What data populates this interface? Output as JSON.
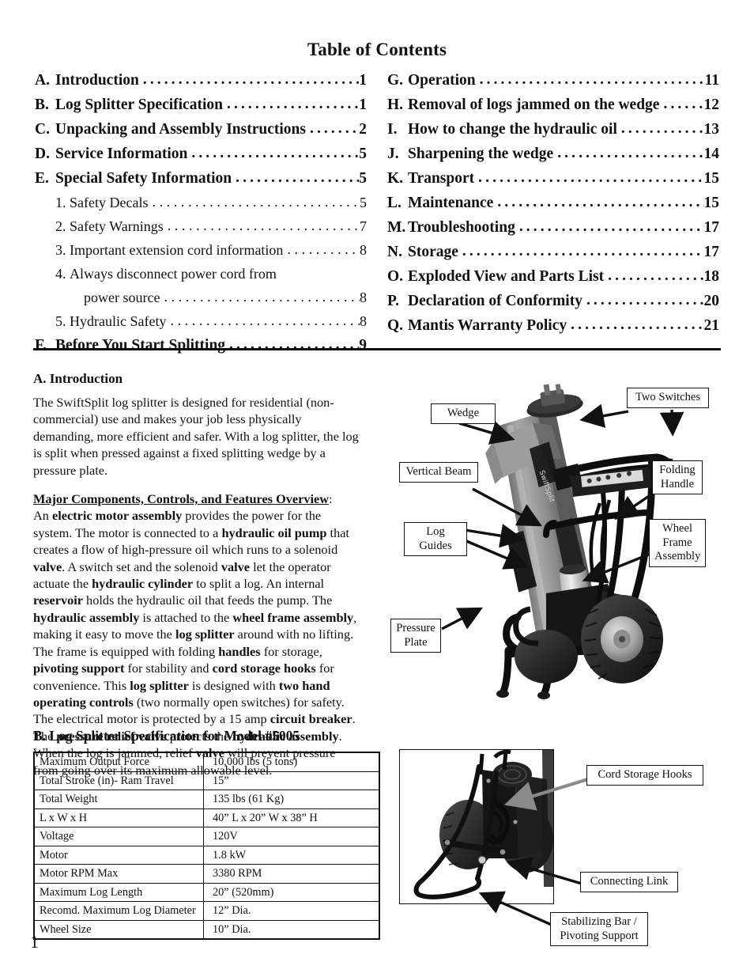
{
  "document": {
    "toc_title": "Table of Contents",
    "page_number": "1"
  },
  "toc": {
    "left_column": [
      {
        "letter": "A.",
        "text": "Introduction",
        "page": "1",
        "level": "main"
      },
      {
        "letter": "B.",
        "text": "Log Splitter Specification",
        "page": "1",
        "level": "main"
      },
      {
        "letter": "C.",
        "text": "Unpacking and Assembly Instructions",
        "page": "2",
        "level": "main"
      },
      {
        "letter": "D.",
        "text": "Service Information",
        "page": "5",
        "level": "main"
      },
      {
        "letter": "E.",
        "text": "Special Safety Information",
        "page": "5",
        "level": "main"
      },
      {
        "letter": "1.",
        "text": "Safety Decals",
        "page": "5",
        "level": "sub"
      },
      {
        "letter": "2.",
        "text": "Safety Warnings",
        "page": "7",
        "level": "sub"
      },
      {
        "letter": "3.",
        "text": "Important extension cord information",
        "page": "8",
        "level": "sub"
      },
      {
        "letter": "4.",
        "text": "Always disconnect power cord from",
        "page": "",
        "level": "sub-nodots"
      },
      {
        "letter": "",
        "text": "power source",
        "page": "8",
        "level": "sub-cont"
      },
      {
        "letter": "5.",
        "text": "Hydraulic Safety",
        "page": "8",
        "level": "sub"
      },
      {
        "letter": "F.",
        "text": "Before You Start Splitting",
        "page": "9",
        "level": "main"
      }
    ],
    "right_column": [
      {
        "letter": "G.",
        "text": "Operation",
        "page": "11",
        "level": "main"
      },
      {
        "letter": "H.",
        "text": "Removal of logs jammed on the wedge",
        "page": "12",
        "level": "main"
      },
      {
        "letter": "I.",
        "text": "How to change the hydraulic oil",
        "page": "13",
        "level": "main"
      },
      {
        "letter": "J.",
        "text": "Sharpening the wedge",
        "page": "14",
        "level": "main"
      },
      {
        "letter": "K.",
        "text": "Transport",
        "page": "15",
        "level": "main"
      },
      {
        "letter": "L.",
        "text": "Maintenance",
        "page": "15",
        "level": "main"
      },
      {
        "letter": "M.",
        "text": "Troubleshooting",
        "page": "17",
        "level": "main"
      },
      {
        "letter": "N.",
        "text": "Storage",
        "page": "17",
        "level": "main"
      },
      {
        "letter": "O.",
        "text": "Exploded View and Parts List",
        "page": "18",
        "level": "main"
      },
      {
        "letter": "P.",
        "text": "Declaration of Conformity",
        "page": "20",
        "level": "main"
      },
      {
        "letter": "Q.",
        "text": "Mantis Warranty Policy",
        "page": "21",
        "level": "main"
      }
    ]
  },
  "section_a": {
    "heading": "A. Introduction",
    "paragraph1": "The SwiftSplit log splitter is designed for residential (non-commercial) use and makes your job less physically demanding, more efficient and safer. With a log splitter, the log is split when pressed against a fixed splitting wedge by a pressure plate.",
    "overview_heading": "Major Components, Controls, and Features Overview",
    "overview_heading_colon": ":",
    "overview_body": "An electric motor assembly provides the power for the system. The motor is connected to a hydraulic oil pump that creates a flow of high-pressure oil which runs to a solenoid valve. A switch set and the solenoid valve let the operator actuate the hydraulic cylinder to split a log. An internal reservoir holds the hydraulic oil that feeds the pump. The hydraulic assembly is attached to the wheel frame assembly, making it easy to move the log splitter around with no lifting. The frame is equipped with folding handles for storage, pivoting support for stability and cord storage hooks for convenience. This log splitter is designed with two hand operating controls (two normally open switches) for safety. The electrical motor is protected by a 15 amp circuit breaker. The pressure relief valve protects the hydraulic assembly. When the log is jammed, relief valve will prevent pressure from going over its maximum allowable level."
  },
  "section_b": {
    "heading": "B. Log Splitter Specification for Model #5005",
    "spec_rows": [
      {
        "label": "Maximum Output Force",
        "value": "10,000 lbs (5 tons)"
      },
      {
        "label": "Total Stroke (in)- Ram Travel",
        "value": "15”"
      },
      {
        "label": "Total Weight",
        "value": "135 lbs (61 Kg)"
      },
      {
        "label": "L x W x H",
        "value": "40” L x 20” W x 38” H"
      },
      {
        "label": "Voltage",
        "value": "120V"
      },
      {
        "label": "Motor",
        "value": "1.8 kW"
      },
      {
        "label": "Motor RPM Max",
        "value": "3380 RPM"
      },
      {
        "label": "Maximum Log Length",
        "value": "20” (520mm)"
      },
      {
        "label": "Recomd. Maximum Log Diameter",
        "value": "12” Dia."
      },
      {
        "label": "Wheel Size",
        "value": "10” Dia."
      }
    ]
  },
  "figure_main": {
    "callouts": {
      "two_switches": "Two Switches",
      "wedge": "Wedge",
      "vertical_beam": "Vertical Beam",
      "log_guides": "Log Guides",
      "pressure_plate": "Pressure\nPlate",
      "folding_handle": "Folding\nHandle",
      "wheel_frame_assembly": "Wheel\nFrame\nAssembly"
    }
  },
  "figure_base": {
    "callouts": {
      "cord_storage_hooks": "Cord Storage Hooks",
      "connecting_link": "Connecting Link",
      "stabilizing_bar": "Stabilizing Bar /\nPivoting Support"
    }
  },
  "colors": {
    "ink": "#111111",
    "paper": "#ffffff",
    "metal_gray": "#8e8e8e",
    "dark_metal": "#2b2b2b",
    "mid_gray": "#6e6e6e"
  }
}
